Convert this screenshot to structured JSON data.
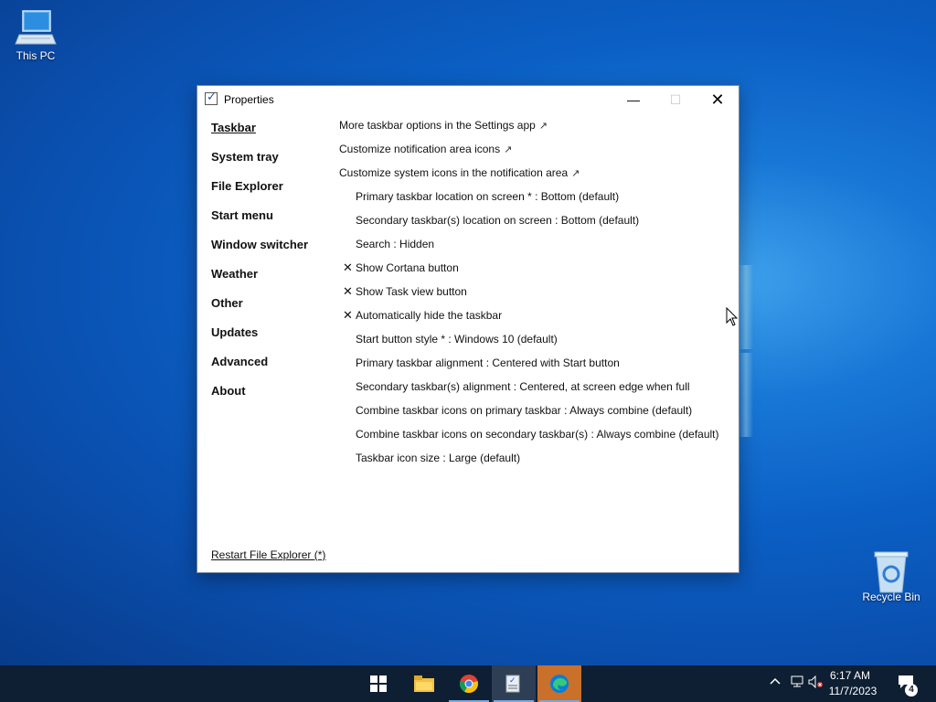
{
  "desktop": {
    "icons": [
      {
        "label": "This PC",
        "icon": "computer-icon"
      },
      {
        "label": "Recycle Bin",
        "icon": "recycle-bin-icon"
      }
    ]
  },
  "window": {
    "title": "Properties",
    "controls": {
      "minimize": "—",
      "maximize": "☐",
      "close": "✕"
    },
    "nav": [
      {
        "label": "Taskbar",
        "active": true
      },
      {
        "label": "System tray"
      },
      {
        "label": "File Explorer"
      },
      {
        "label": "Start menu"
      },
      {
        "label": "Window switcher"
      },
      {
        "label": "Weather"
      },
      {
        "label": "Other"
      },
      {
        "label": "Updates"
      },
      {
        "label": "Advanced"
      },
      {
        "label": "About"
      }
    ],
    "links": [
      {
        "label": "More taskbar options in the Settings app",
        "arrow": "↗"
      },
      {
        "label": "Customize notification area icons",
        "arrow": "↗"
      },
      {
        "label": "Customize system icons in the notification area",
        "arrow": "↗"
      }
    ],
    "options": [
      {
        "label": "Primary taskbar location on screen * : Bottom (default)"
      },
      {
        "label": "Secondary taskbar(s) location on screen : Bottom (default)"
      },
      {
        "label": "Search : Hidden"
      },
      {
        "label": "Show Cortana button",
        "checked": "✕"
      },
      {
        "label": "Show Task view button",
        "checked": "✕"
      },
      {
        "label": "Automatically hide the taskbar",
        "checked": "✕"
      },
      {
        "label": "Start button style * : Windows 10 (default)"
      },
      {
        "label": "Primary taskbar alignment : Centered with Start button"
      },
      {
        "label": "Secondary taskbar(s) alignment : Centered, at screen edge when full"
      },
      {
        "label": "Combine taskbar icons on primary taskbar : Always combine (default)"
      },
      {
        "label": "Combine taskbar icons on secondary taskbar(s) : Always combine (default)"
      },
      {
        "label": "Taskbar icon size : Large (default)"
      }
    ],
    "restart_link": "Restart File Explorer (*)"
  },
  "taskbar": {
    "apps": [
      {
        "name": "start-button",
        "icon": "windows-logo-icon"
      },
      {
        "name": "file-explorer",
        "icon": "folder-icon"
      },
      {
        "name": "chrome",
        "icon": "chrome-icon"
      },
      {
        "name": "properties-app",
        "icon": "properties-app-icon"
      },
      {
        "name": "edge",
        "icon": "edge-icon"
      }
    ],
    "tray": {
      "time": "6:17 AM",
      "date": "11/7/2023",
      "notifications_count": "4"
    }
  }
}
